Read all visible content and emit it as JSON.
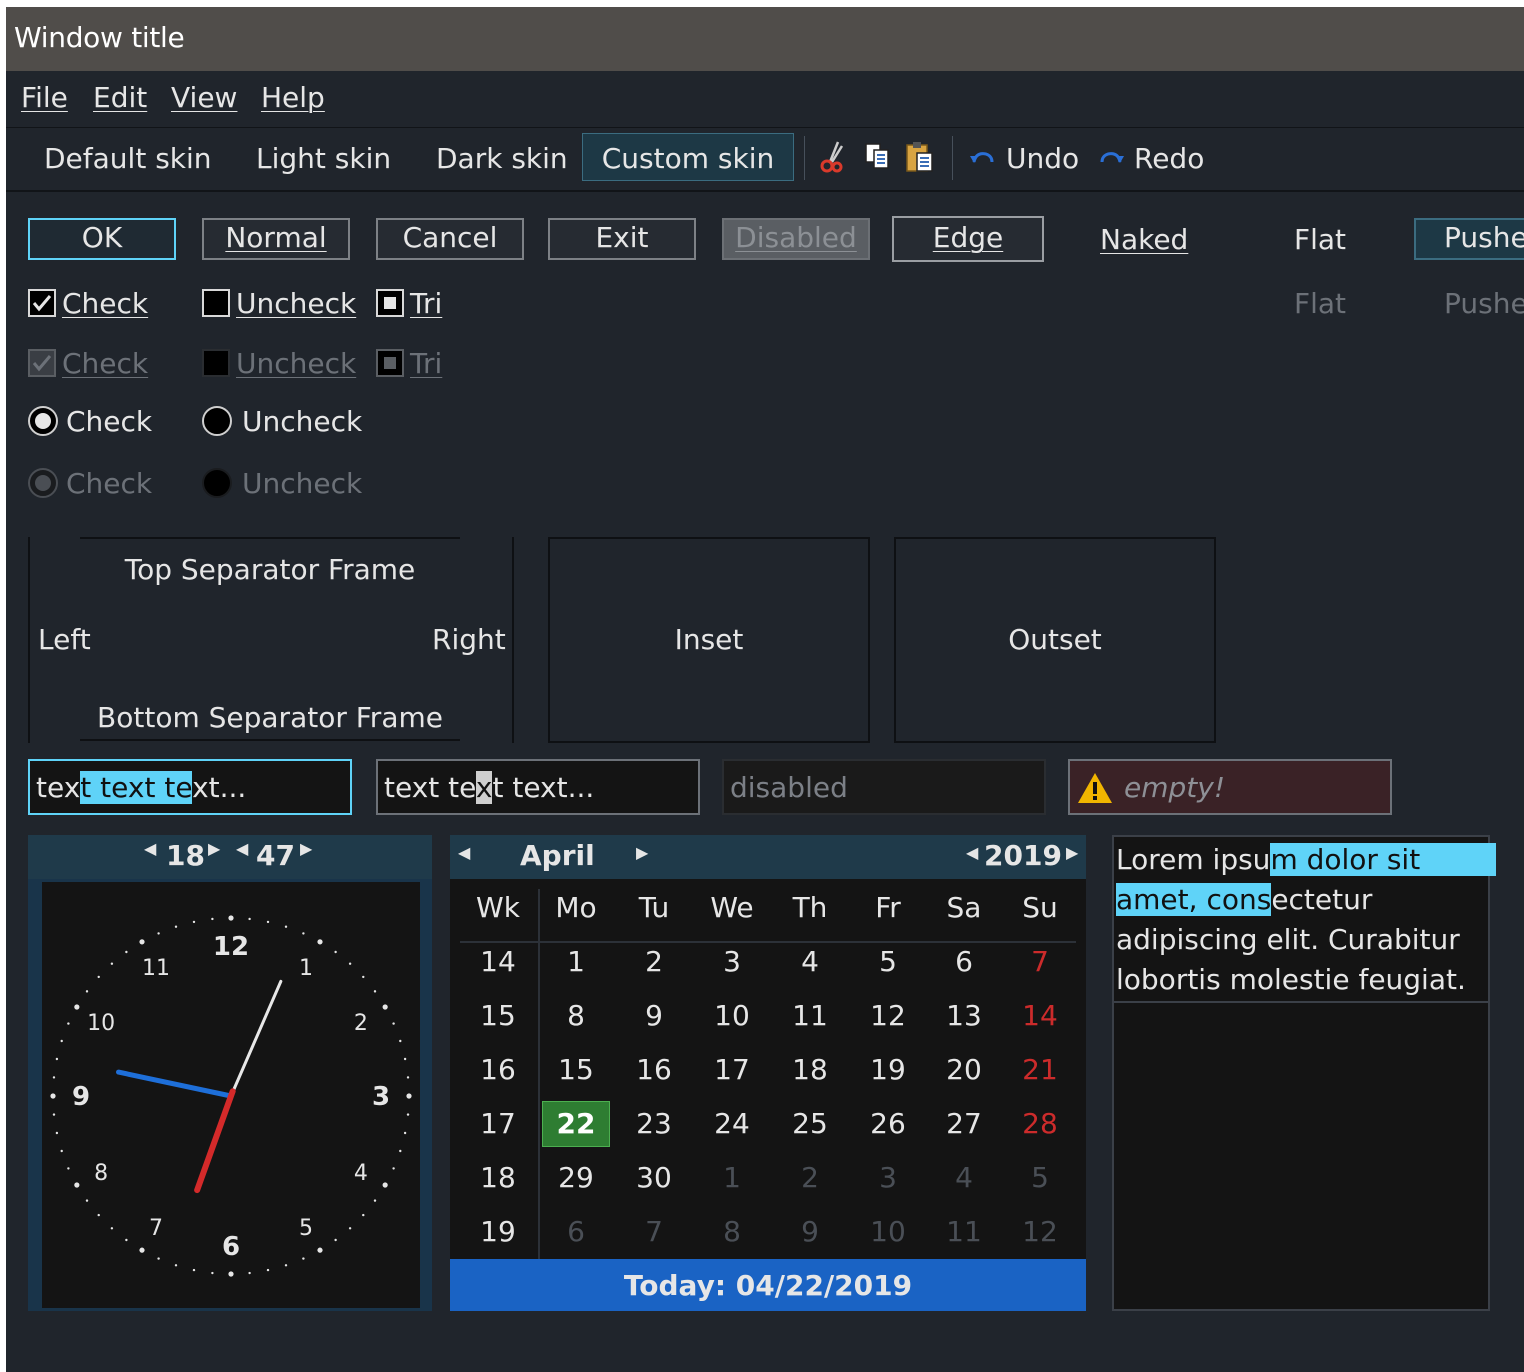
{
  "window": {
    "title": "Window title"
  },
  "menu": [
    "File",
    "Edit",
    "View",
    "Help"
  ],
  "toolbar": {
    "skins": [
      "Default skin",
      "Light skin",
      "Dark skin",
      "Custom skin"
    ],
    "active_skin": "Custom skin",
    "icons": [
      "cut-icon",
      "copy-icon",
      "paste-icon",
      "undo-icon",
      "redo-icon"
    ],
    "undo": "Undo",
    "redo": "Redo"
  },
  "buttons": {
    "ok": "OK",
    "normal": "Normal",
    "cancel": "Cancel",
    "exit": "Exit",
    "disabled": "Disabled",
    "edge": "Edge",
    "naked": "Naked",
    "flat": "Flat",
    "pushed": "Pushed",
    "flat2": "Flat",
    "pushed2": "Pushed"
  },
  "checkboxes": {
    "check": "Check",
    "uncheck": "Uncheck",
    "tri": "Tri",
    "check_disabled": "Check",
    "uncheck_disabled": "Uncheck",
    "tri_disabled": "Tri"
  },
  "radios": {
    "check": "Check",
    "uncheck": "Uncheck",
    "check_disabled": "Check",
    "uncheck_disabled": "Uncheck"
  },
  "frames": {
    "top": "Top Separator Frame",
    "left": "Left",
    "right": "Right",
    "bottom": "Bottom Separator Frame",
    "inset": "Inset",
    "outset": "Outset"
  },
  "fields": {
    "field1": {
      "pre": "tex",
      "sel": "t text te",
      "post": "xt..."
    },
    "field2": {
      "pre": "tex",
      "mid": "t te",
      "sel": "x",
      "post": "t text..."
    },
    "disabled": "disabled",
    "empty_warning": "empty!"
  },
  "clock": {
    "hour": "18",
    "minute": "47",
    "numbers": [
      "12",
      "1",
      "2",
      "3",
      "4",
      "5",
      "6",
      "7",
      "8",
      "9",
      "10",
      "11"
    ]
  },
  "calendar": {
    "month": "April",
    "year": "2019",
    "headers": [
      "Wk",
      "Mo",
      "Tu",
      "We",
      "Th",
      "Fr",
      "Sa",
      "Su"
    ],
    "rows": [
      [
        "14",
        "1",
        "2",
        "3",
        "4",
        "5",
        "6",
        "7"
      ],
      [
        "15",
        "8",
        "9",
        "10",
        "11",
        "12",
        "13",
        "14"
      ],
      [
        "16",
        "15",
        "16",
        "17",
        "18",
        "19",
        "20",
        "21"
      ],
      [
        "17",
        "22",
        "23",
        "24",
        "25",
        "26",
        "27",
        "28"
      ],
      [
        "18",
        "29",
        "30",
        "1",
        "2",
        "3",
        "4",
        "5"
      ],
      [
        "19",
        "6",
        "7",
        "8",
        "9",
        "10",
        "11",
        "12"
      ]
    ],
    "today": "Today: 04/22/2019",
    "selected": "22",
    "colors": {
      "sunday": "#cc2b2b",
      "selected_bg": "#2e7d32",
      "footer": "#1a63c4",
      "other_month": "#4a4f56"
    }
  },
  "textarea": {
    "lines": [
      {
        "pre": "Lorem ipsu",
        "sel": "m dolor sit",
        "post": ""
      },
      {
        "pre": "",
        "sel": "amet, cons",
        "post": "ectetur"
      },
      {
        "pre": "adipiscing elit. Curabitur",
        "sel": "",
        "post": ""
      },
      {
        "pre": "lobortis molestie feugiat.",
        "sel": "",
        "post": ""
      }
    ]
  },
  "colors": {
    "accent": "#5fd3f8",
    "background": "#20252c",
    "titlebar": "#504d4a"
  }
}
